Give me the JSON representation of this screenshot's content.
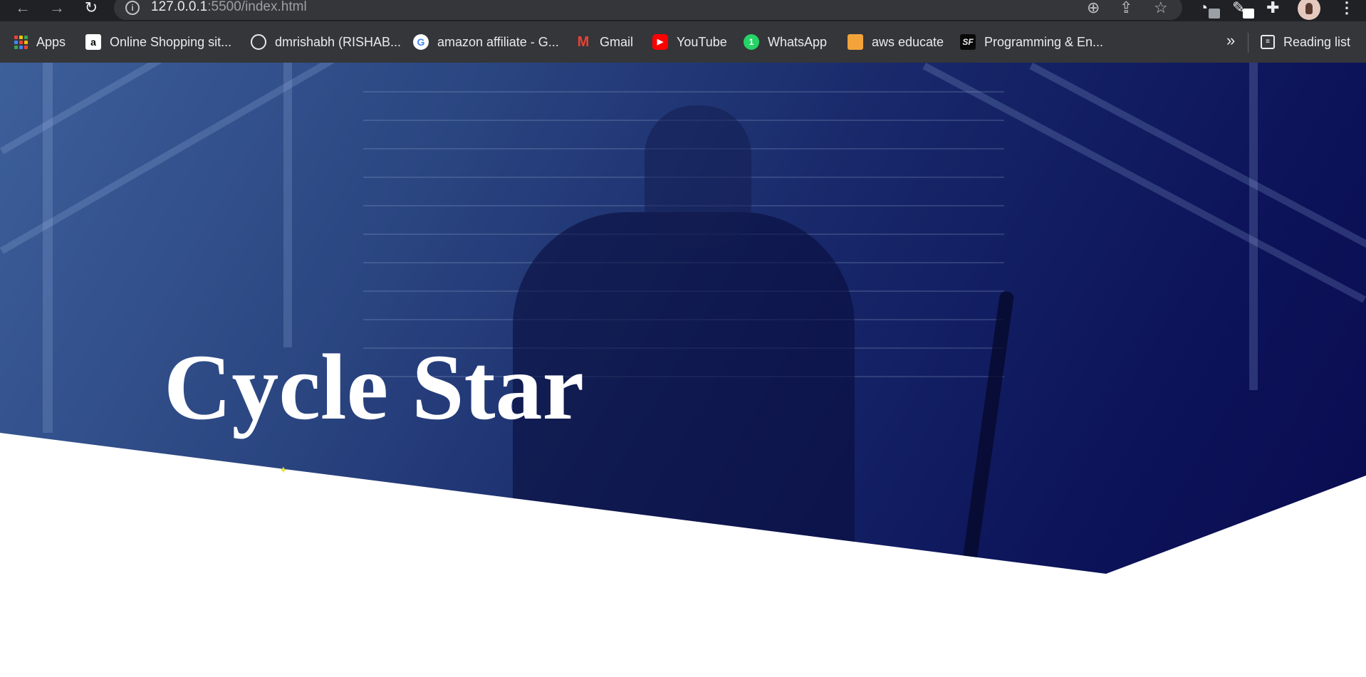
{
  "browser": {
    "url_host": "127.0.0.1",
    "url_rest": ":5500/index.html",
    "icons": [
      "back-arrow-icon",
      "forward-arrow-icon",
      "reload-icon",
      "info-icon",
      "zoom-icon",
      "share-icon",
      "star-icon",
      "extension-icon",
      "pen-icon",
      "puzzle-icon",
      "avatar",
      "menu-icon"
    ]
  },
  "bookmarks": [
    {
      "label": "Apps"
    },
    {
      "label": "Online Shopping sit..."
    },
    {
      "label": "dmrishabh (RISHAB..."
    },
    {
      "label": "amazon affiliate - G..."
    },
    {
      "label": "Gmail"
    },
    {
      "label": "YouTube"
    },
    {
      "label": "WhatsApp"
    },
    {
      "label": "aws educate"
    },
    {
      "label": "Programming & En..."
    }
  ],
  "reading_list": {
    "label": "Reading list",
    "overflow": "»"
  },
  "hero": {
    "title": "Cycle Star"
  },
  "colors": {
    "chrome_dark": "#202124",
    "bookmarks_bar": "#35363a",
    "hero_start": "#3d5f9a",
    "hero_end": "#0a0b50"
  }
}
